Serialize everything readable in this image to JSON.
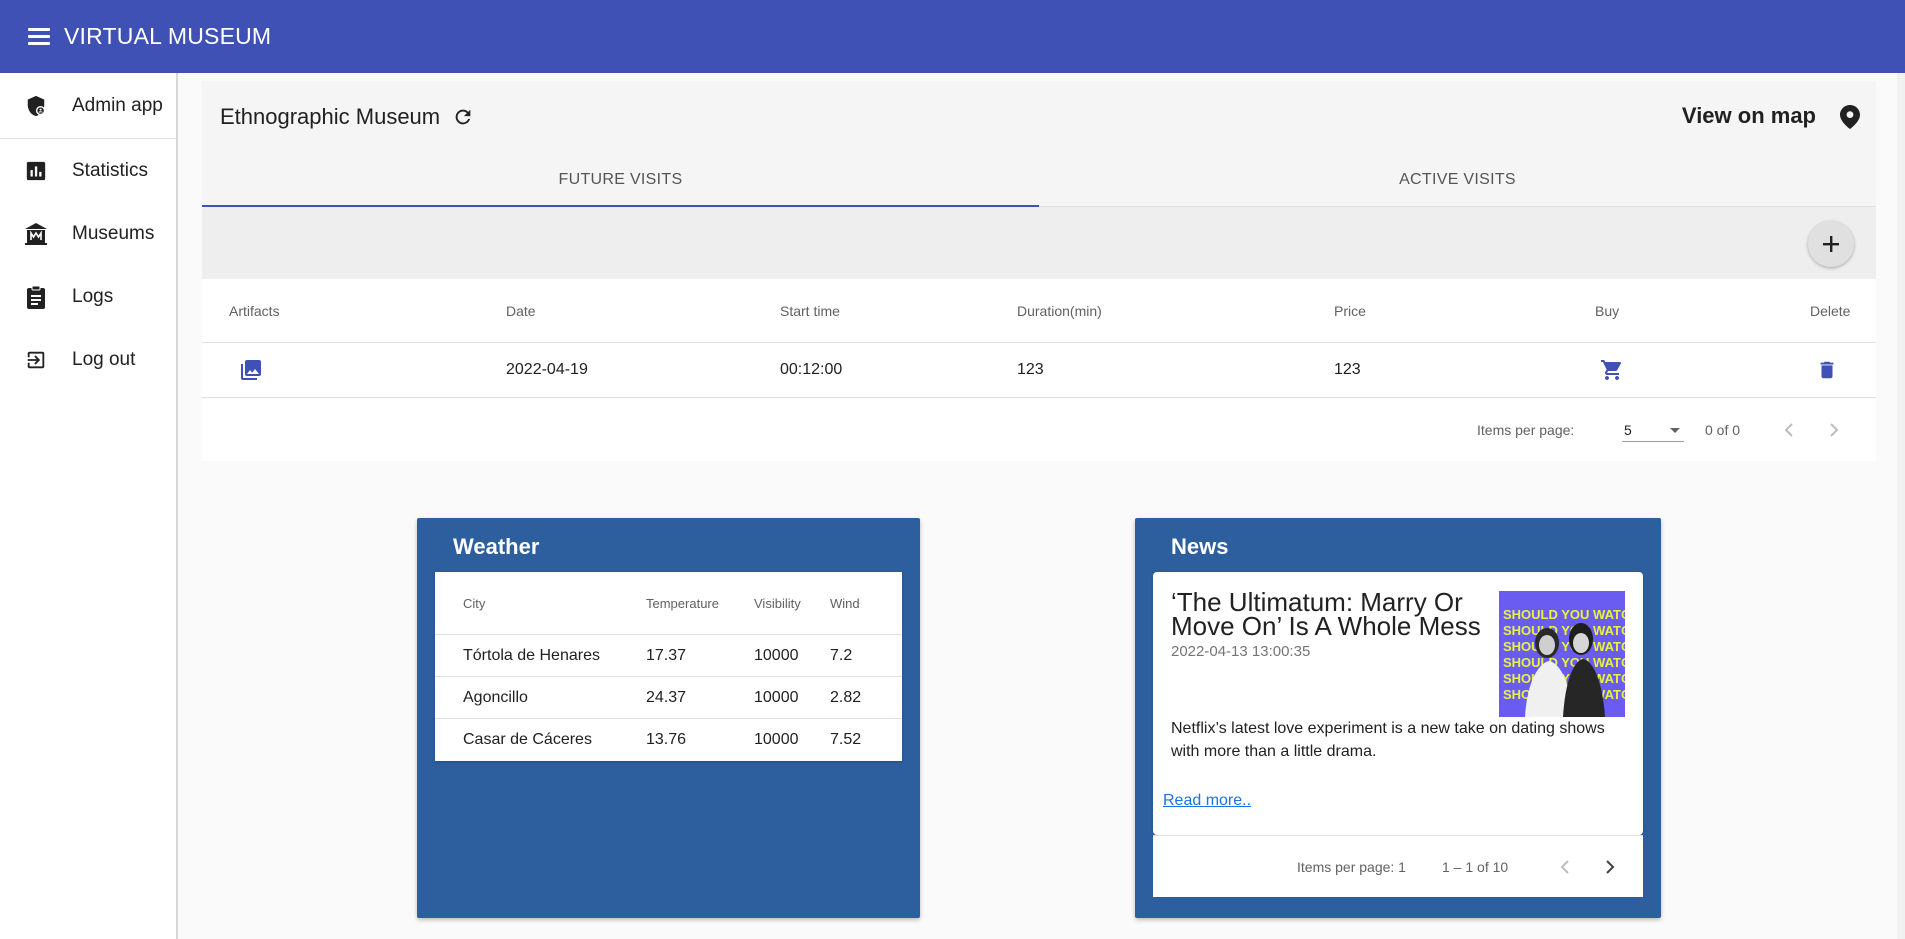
{
  "app": {
    "title": "VIRTUAL MUSEUM"
  },
  "sidebar": {
    "items": [
      {
        "label": "Admin app",
        "icon": "admin-shield-icon"
      },
      {
        "label": "Statistics",
        "icon": "bar-chart-icon"
      },
      {
        "label": "Museums",
        "icon": "museum-icon"
      },
      {
        "label": "Logs",
        "icon": "clipboard-icon"
      },
      {
        "label": "Log out",
        "icon": "logout-icon"
      }
    ]
  },
  "museum": {
    "name": "Ethnographic Museum",
    "view_on_map": "View on map"
  },
  "tabs": [
    {
      "label": "FUTURE VISITS",
      "active": true
    },
    {
      "label": "ACTIVE VISITS",
      "active": false
    }
  ],
  "visits": {
    "columns": [
      "Artifacts",
      "Date",
      "Start time",
      "Duration(min)",
      "Price",
      "Buy",
      "Delete"
    ],
    "rows": [
      {
        "date": "2022-04-19",
        "start_time": "00:12:00",
        "duration": "123",
        "price": "123"
      }
    ],
    "paginator": {
      "items_per_page_label": "Items per page:",
      "items_per_page": "5",
      "range": "0 of 0"
    }
  },
  "weather": {
    "title": "Weather",
    "columns": [
      "City",
      "Temperature",
      "Visibility",
      "Wind"
    ],
    "rows": [
      {
        "city": "Tórtola de Henares",
        "temperature": "17.37",
        "visibility": "10000",
        "wind": "7.2"
      },
      {
        "city": "Agoncillo",
        "temperature": "24.37",
        "visibility": "10000",
        "wind": "2.82"
      },
      {
        "city": "Casar de Cáceres",
        "temperature": "13.76",
        "visibility": "10000",
        "wind": "7.52"
      }
    ]
  },
  "news": {
    "title": "News",
    "headline": "‘The Ultimatum: Marry Or Move On’ Is A Whole Mess",
    "date": "2022-04-13 13:00:35",
    "description": "Netflix’s latest love experiment is a new take on dating shows with more than a little drama.",
    "read_more": "Read more..",
    "thumbnail_text": "SHOULD YOU WATCH IT?",
    "paginator": {
      "items_per_page_label": "Items per page: 1",
      "range": "1 – 1 of 10"
    }
  },
  "colors": {
    "primary": "#3f51b5",
    "card_blue": "#2d5f9e",
    "link": "#1a73e8"
  }
}
